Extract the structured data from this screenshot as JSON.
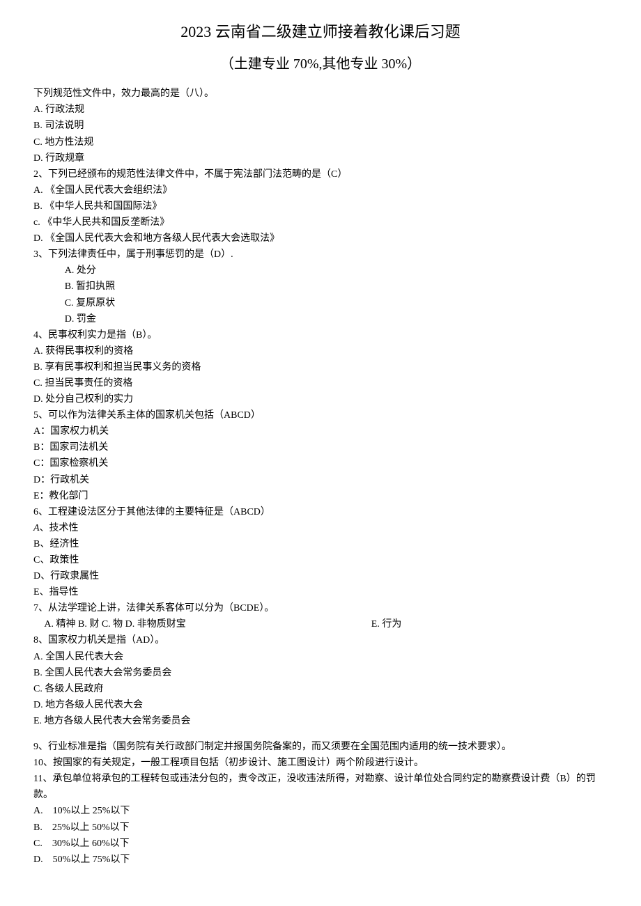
{
  "title": {
    "main": "2023 云南省二级建立师接着教化课后习题",
    "sub": "（土建专业 70%,其他专业 30%）"
  },
  "q1": {
    "stem": "下列规范性文件中，效力最高的是（八）。",
    "a": "A. 行政法规",
    "b": "B. 司法说明",
    "c": "C. 地方性法规",
    "d": "D. 行政规章"
  },
  "q2": {
    "stem": "2、下列已经颁布的规范性法律文件中，不属于宪法部门法范畴的是（C）",
    "a": "A. 《全国人民代表大会组织法》",
    "b": "B. 《中华人民共和国国际法》",
    "c": "c. 《中华人民共和国反垄断法》",
    "d": "D. 《全国人民代表大会和地方各级人民代表大会选取法》"
  },
  "q3": {
    "stem": "3、下列法律责任中，属于刑事惩罚的是（D）.",
    "a": "A. 处分",
    "b": "B. 暂扣执照",
    "c": "C. 复原原状",
    "d": "D. 罚金"
  },
  "q4": {
    "stem": "4、民事权利实力是指（B）。",
    "a": "A. 获得民事权利的资格",
    "b": "B. 享有民事权利和担当民事义务的资格",
    "c": "C. 担当民事责任的资格",
    "d": "D. 处分自己权利的实力"
  },
  "q5": {
    "stem": "5、可以作为法律关系主体的国家机关包括（ABCD）",
    "a": "A：国家权力机关",
    "b": "B：国家司法机关",
    "c": "C：国家检察机关",
    "d": "D：行政机关",
    "e": "E：教化部门"
  },
  "q6": {
    "stem": "6、工程建设法区分于其他法律的主要特征是（ABCD）",
    "a": "A、技术性",
    "b": "B、经济性",
    "c": "C、政策性",
    "d": "D、行政隶属性",
    "e": "E、指导性"
  },
  "q7": {
    "stem": "7、从法学理论上讲，法律关系客体可以分为（BCDE）。",
    "opts_left": "A. 精神 B. 财 C. 物 D. 非物质财宝",
    "opts_right": "E. 行为"
  },
  "q8": {
    "stem": "8、国家权力机关是指（AD）。",
    "a": "A. 全国人民代表大会",
    "b": "B. 全国人民代表大会常务委员会",
    "c": "C. 各级人民政府",
    "d": "D. 地方各级人民代表大会",
    "e": "E. 地方各级人民代表大会常务委员会"
  },
  "q9": {
    "stem": "9、行业标准是指（国务院有关行政部门制定并报国务院备案的，而又须要在全国范围内适用的统一技术要求）。"
  },
  "q10": {
    "stem": "10、按国家的有关规定，一般工程项目包括（初步设计、施工图设计）两个阶段进行设计。"
  },
  "q11": {
    "stem": "11、承包单位将承包的工程转包或违法分包的，责令改正，没收违法所得，对勘察、设计单位处合同约定的勘察费设计费（B）的罚款。",
    "a": "A.　10%以上 25%以下",
    "b": "B.　25%以上 50%以下",
    "c": "C.　30%以上 60%以下",
    "d": "D.　50%以上 75%以下"
  }
}
